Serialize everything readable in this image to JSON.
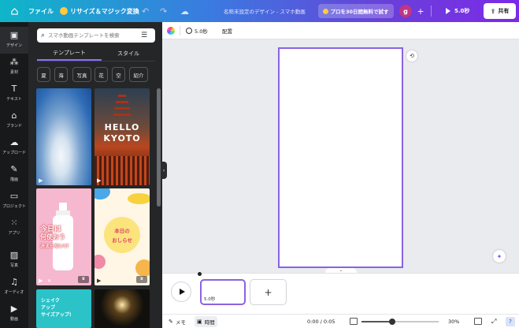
{
  "topbar": {
    "file": "ファイル",
    "resize": "リサイズ＆マジック変換",
    "doc_name": "名称未設定のデザイン - スマホ動画",
    "pro_trial": "プロを30日間無料で試す",
    "avatar_initial": "g",
    "present": "5.0秒",
    "share": "共有"
  },
  "rail": [
    {
      "icon": "design-icon",
      "label": "デザイン"
    },
    {
      "icon": "elements-icon",
      "label": "素材"
    },
    {
      "icon": "text-icon",
      "label": "テキスト"
    },
    {
      "icon": "brand-icon",
      "label": "ブランド"
    },
    {
      "icon": "upload-icon",
      "label": "アップロード"
    },
    {
      "icon": "draw-icon",
      "label": "描画"
    },
    {
      "icon": "project-icon",
      "label": "プロジェクト"
    },
    {
      "icon": "apps-icon",
      "label": "アプリ"
    },
    {
      "icon": "photos-icon",
      "label": "写真"
    },
    {
      "icon": "audio-icon",
      "label": "オーディオ"
    },
    {
      "icon": "video-icon",
      "label": "動画"
    }
  ],
  "panel": {
    "search_placeholder": "スマホ動画テンプレートを検索",
    "tabs": [
      "テンプレート",
      "スタイル"
    ],
    "chips": [
      "夏",
      "海",
      "写真",
      "花",
      "空",
      "紹介"
    ],
    "thumbs": {
      "kyoto_title_1": "HELLO",
      "kyoto_title_2": "KYOTO",
      "pink_line_1": "今日は",
      "pink_line_2": "何使おう",
      "pink_line_3": "決まらない!?",
      "osirase_line_1": "本日の",
      "osirase_line_2": "おしらせ",
      "teal_line_1": "シェイク",
      "teal_line_2": "アップ",
      "teal_line_3": "サイズアップ!"
    }
  },
  "context_bar": {
    "duration": "5.0秒",
    "arrange": "配置"
  },
  "timeline": {
    "clip_label": "5.0秒"
  },
  "statusbar": {
    "memo": "メモ",
    "time": "時間",
    "counter": "0:00 / 0:05",
    "zoom": "30%",
    "zoom_fraction": 0.4
  },
  "colors": {
    "accent": "#8b62e0",
    "rail_bg": "#18191b",
    "panel_bg": "#252627"
  }
}
